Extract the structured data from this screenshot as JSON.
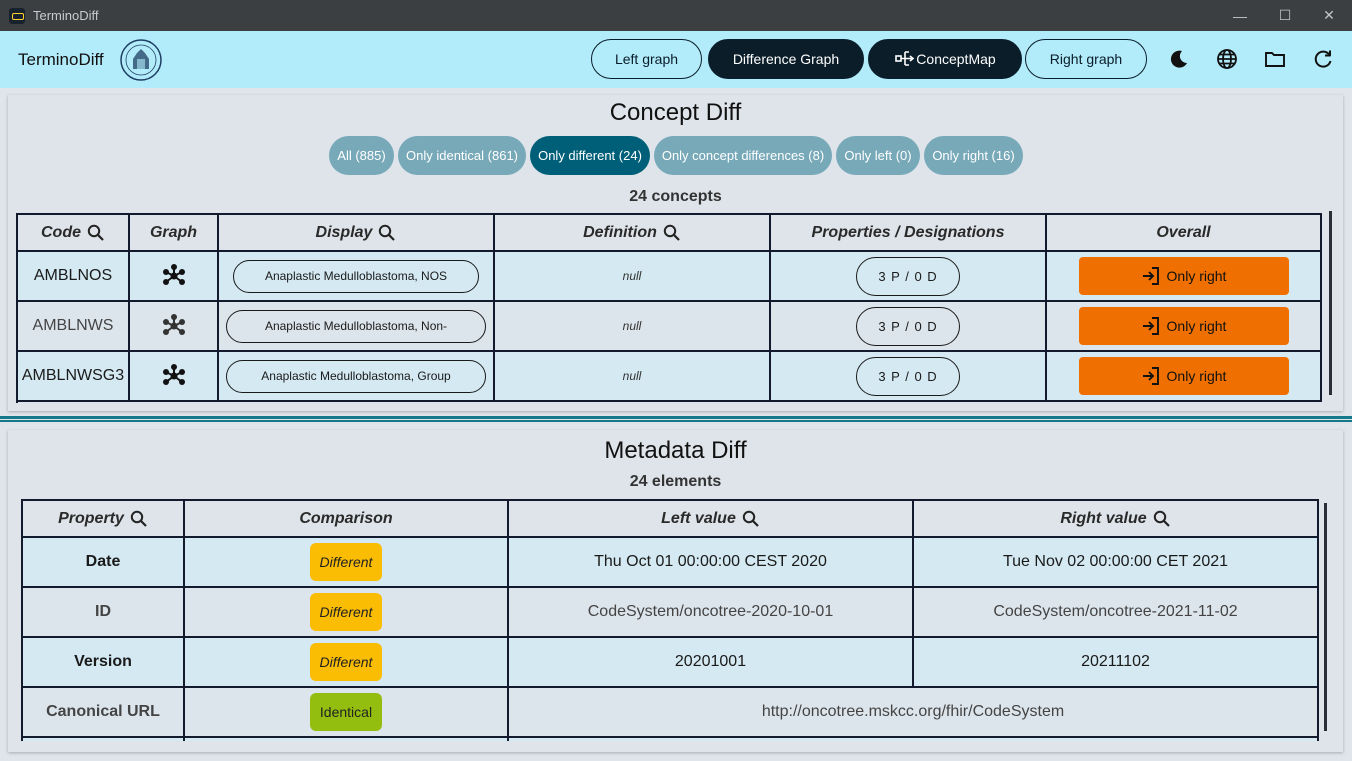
{
  "window": {
    "title": "TerminoDiff",
    "controls": {
      "minimize": "—",
      "maximize": "☐",
      "close": "✕"
    }
  },
  "appbar": {
    "title": "TerminoDiff",
    "nav": [
      {
        "label": "Left graph",
        "active": false
      },
      {
        "label": "Difference Graph",
        "active": true
      },
      {
        "label": "ConceptMap",
        "active": true,
        "icon": "flowchart-icon"
      },
      {
        "label": "Right graph",
        "active": false
      }
    ],
    "icons": [
      "dark-mode-icon",
      "globe-icon",
      "folder-icon",
      "refresh-icon"
    ]
  },
  "concept_diff": {
    "title": "Concept Diff",
    "filters": [
      {
        "label": "All (885)",
        "selected": false
      },
      {
        "label": "Only identical (861)",
        "selected": false
      },
      {
        "label": "Only different (24)",
        "selected": true
      },
      {
        "label": "Only concept differences (8)",
        "selected": false
      },
      {
        "label": "Only left (0)",
        "selected": false
      },
      {
        "label": "Only right (16)",
        "selected": false
      }
    ],
    "count_label": "24 concepts",
    "columns": [
      "Code",
      "Graph",
      "Display",
      "Definition",
      "Properties / Designations",
      "Overall"
    ],
    "rows": [
      {
        "code": "AMBLNOS",
        "display": "Anaplastic Medulloblastoma, NOS",
        "definition": "null",
        "props": "3 P / 0 D",
        "overall": "Only right"
      },
      {
        "code": "AMBLNWS",
        "display": "Anaplastic Medulloblastoma, Non-",
        "definition": "null",
        "props": "3 P / 0 D",
        "overall": "Only right"
      },
      {
        "code": "AMBLNWSG3",
        "display": "Anaplastic Medulloblastoma, Group",
        "definition": "null",
        "props": "3 P / 0 D",
        "overall": "Only right"
      }
    ]
  },
  "metadata_diff": {
    "title": "Metadata Diff",
    "count_label": "24 elements",
    "columns": [
      "Property",
      "Comparison",
      "Left value",
      "Right value"
    ],
    "rows": [
      {
        "property": "Date",
        "comparison": "Different",
        "left": "Thu Oct 01 00:00:00 CEST 2020",
        "right": "Tue Nov 02 00:00:00 CET 2021"
      },
      {
        "property": "ID",
        "comparison": "Different",
        "left": "CodeSystem/oncotree-2020-10-01",
        "right": "CodeSystem/oncotree-2021-11-02"
      },
      {
        "property": "Version",
        "comparison": "Different",
        "left": "20201001",
        "right": "20211102"
      },
      {
        "property": "Canonical URL",
        "comparison": "Identical",
        "merged": "http://oncotree.mskcc.org/fhir/CodeSystem"
      }
    ]
  },
  "colors": {
    "appbar": "#b2ebf9",
    "chip": "#78a9b8",
    "chip_selected": "#005f78",
    "only_right": "#ef7000",
    "different": "#fbbc04",
    "identical": "#93be0f"
  }
}
